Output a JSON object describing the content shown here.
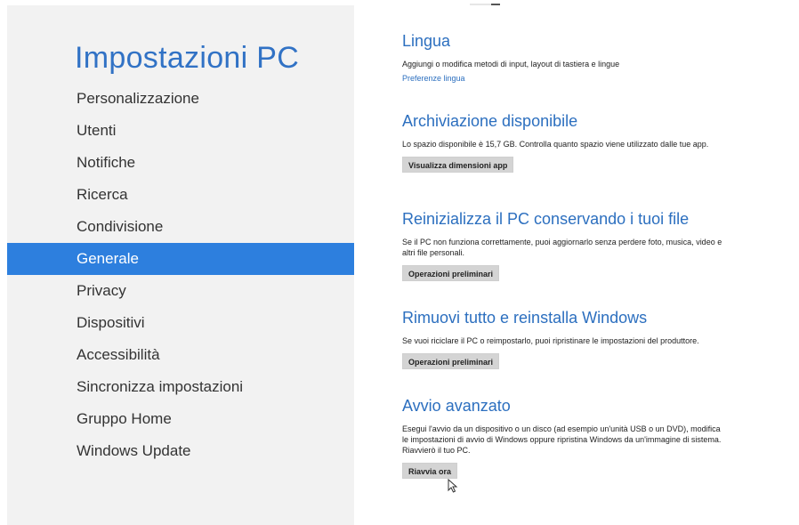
{
  "nav": {
    "title": "Impostazioni PC",
    "items": [
      {
        "label": "Personalizzazione"
      },
      {
        "label": "Utenti"
      },
      {
        "label": "Notifiche"
      },
      {
        "label": "Ricerca"
      },
      {
        "label": "Condivisione"
      },
      {
        "label": "Generale"
      },
      {
        "label": "Privacy"
      },
      {
        "label": "Dispositivi"
      },
      {
        "label": "Accessibilità"
      },
      {
        "label": "Sincronizza impostazioni"
      },
      {
        "label": "Gruppo Home"
      },
      {
        "label": "Windows Update"
      }
    ],
    "selected": "Generale"
  },
  "content": {
    "lingua": {
      "title": "Lingua",
      "description": "Aggiungi o modifica metodi di input, layout di tastiera e lingue",
      "link": "Preferenze lingua"
    },
    "archiviazione": {
      "title": "Archiviazione disponibile",
      "description": "Lo spazio disponibile è 15,7 GB. Controlla quanto spazio viene utilizzato dalle tue app.",
      "button": "Visualizza dimensioni app"
    },
    "reinizializza": {
      "title": "Reinizializza il PC conservando i tuoi file",
      "description": "Se il PC non funziona correttamente, puoi aggiornarlo senza perdere foto, musica, video e altri file personali.",
      "button": "Operazioni preliminari"
    },
    "rimuovi": {
      "title": "Rimuovi tutto e reinstalla Windows",
      "description": "Se vuoi riciclare il PC o reimpostarlo, puoi ripristinare le impostazioni del produttore.",
      "button": "Operazioni preliminari"
    },
    "avvio": {
      "title": "Avvio avanzato",
      "description": "Esegui l'avvio da un dispositivo o un disco (ad esempio un'unità USB o un DVD), modifica le impostazioni di avvio di Windows oppure ripristina Windows da un'immagine di sistema. Riavvierò il tuo PC.",
      "button": "Riavvia ora"
    }
  },
  "colors": {
    "accent": "#2d7fde",
    "title_blue": "#2c6fbf",
    "nav_background": "#f2f2f2",
    "button_background": "#d4d4d4"
  }
}
